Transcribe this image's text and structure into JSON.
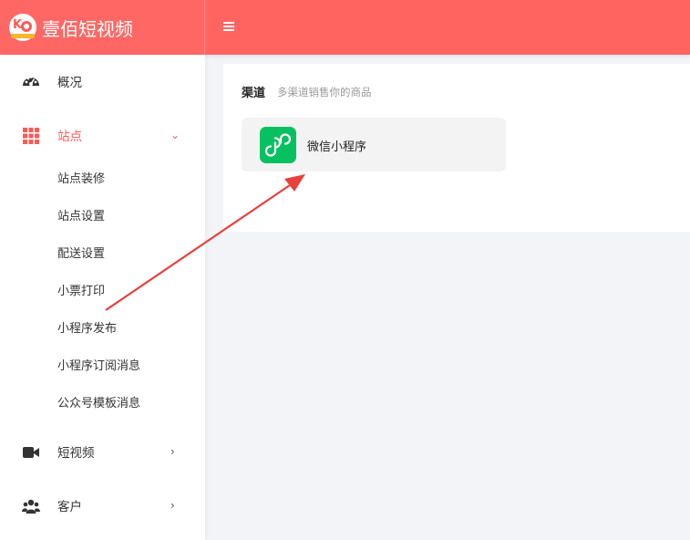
{
  "app": {
    "name": "壹佰短视频"
  },
  "sidebar": {
    "items": [
      {
        "label": "概况",
        "icon": "dashboard-icon"
      },
      {
        "label": "站点",
        "icon": "grid-icon",
        "arrow": "⌄"
      },
      {
        "label": "短视频",
        "icon": "video-camera-icon",
        "arrow": "›"
      },
      {
        "label": "客户",
        "icon": "users-icon",
        "arrow": "›"
      }
    ],
    "sub_items": [
      "站点装修",
      "站点设置",
      "配送设置",
      "小票打印",
      "小程序发布",
      "小程序订阅消息",
      "公众号模板消息"
    ]
  },
  "main": {
    "section_title": "渠道",
    "section_subtitle": "多渠道销售你的商品",
    "channels": [
      {
        "label": "微信小程序",
        "icon": "mini-program-icon"
      }
    ]
  },
  "colors": {
    "brand": "#ff6461",
    "active": "#ff5a57",
    "mini_program": "#07c160",
    "annotation_arrow": "#e8403c"
  }
}
